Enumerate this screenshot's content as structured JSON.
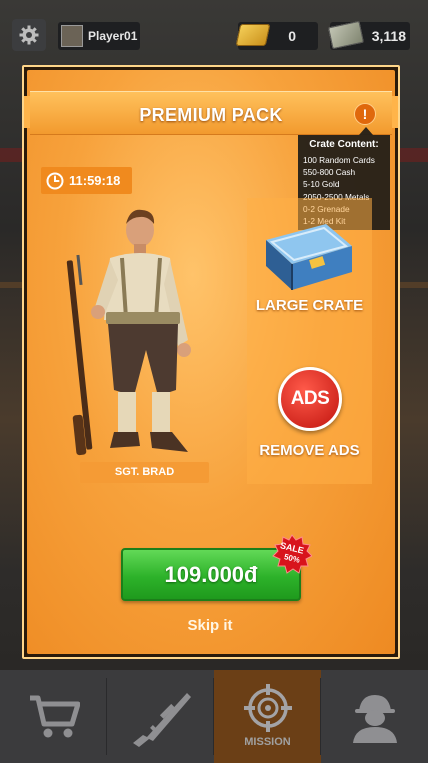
{
  "topbar": {
    "player_name": "Player01",
    "gold": "0",
    "cash": "3,118"
  },
  "modal": {
    "title": "PREMIUM PACK",
    "info_glyph": "!",
    "timer": "11:59:18",
    "character_name": "SGT. BRAD",
    "crate_label": "LARGE CRATE",
    "ads_icon_text": "ADS",
    "remove_ads_label": "REMOVE ADS",
    "price": "109.000đ",
    "sale_text": "SALE",
    "sale_percent": "50%",
    "skip_label": "Skip it"
  },
  "tooltip": {
    "heading": "Crate Content:",
    "lines": [
      "100 Random Cards",
      "550-800 Cash",
      "5-10 Gold",
      "2050-2500 Metals",
      "0-2 Grenade",
      "1-2 Med Kit"
    ]
  },
  "bottom_nav": {
    "items": [
      {
        "icon": "cart-icon",
        "label": ""
      },
      {
        "icon": "rifle-icon",
        "label": ""
      },
      {
        "icon": "crosshair-icon",
        "label": "MISSION"
      },
      {
        "icon": "soldier-icon",
        "label": ""
      }
    ],
    "active_index": 2
  },
  "colors": {
    "modal_orange": "#f7a23c",
    "buy_green": "#2db22a",
    "sale_red": "#d8141c",
    "nav_active": "#6b3f16"
  }
}
